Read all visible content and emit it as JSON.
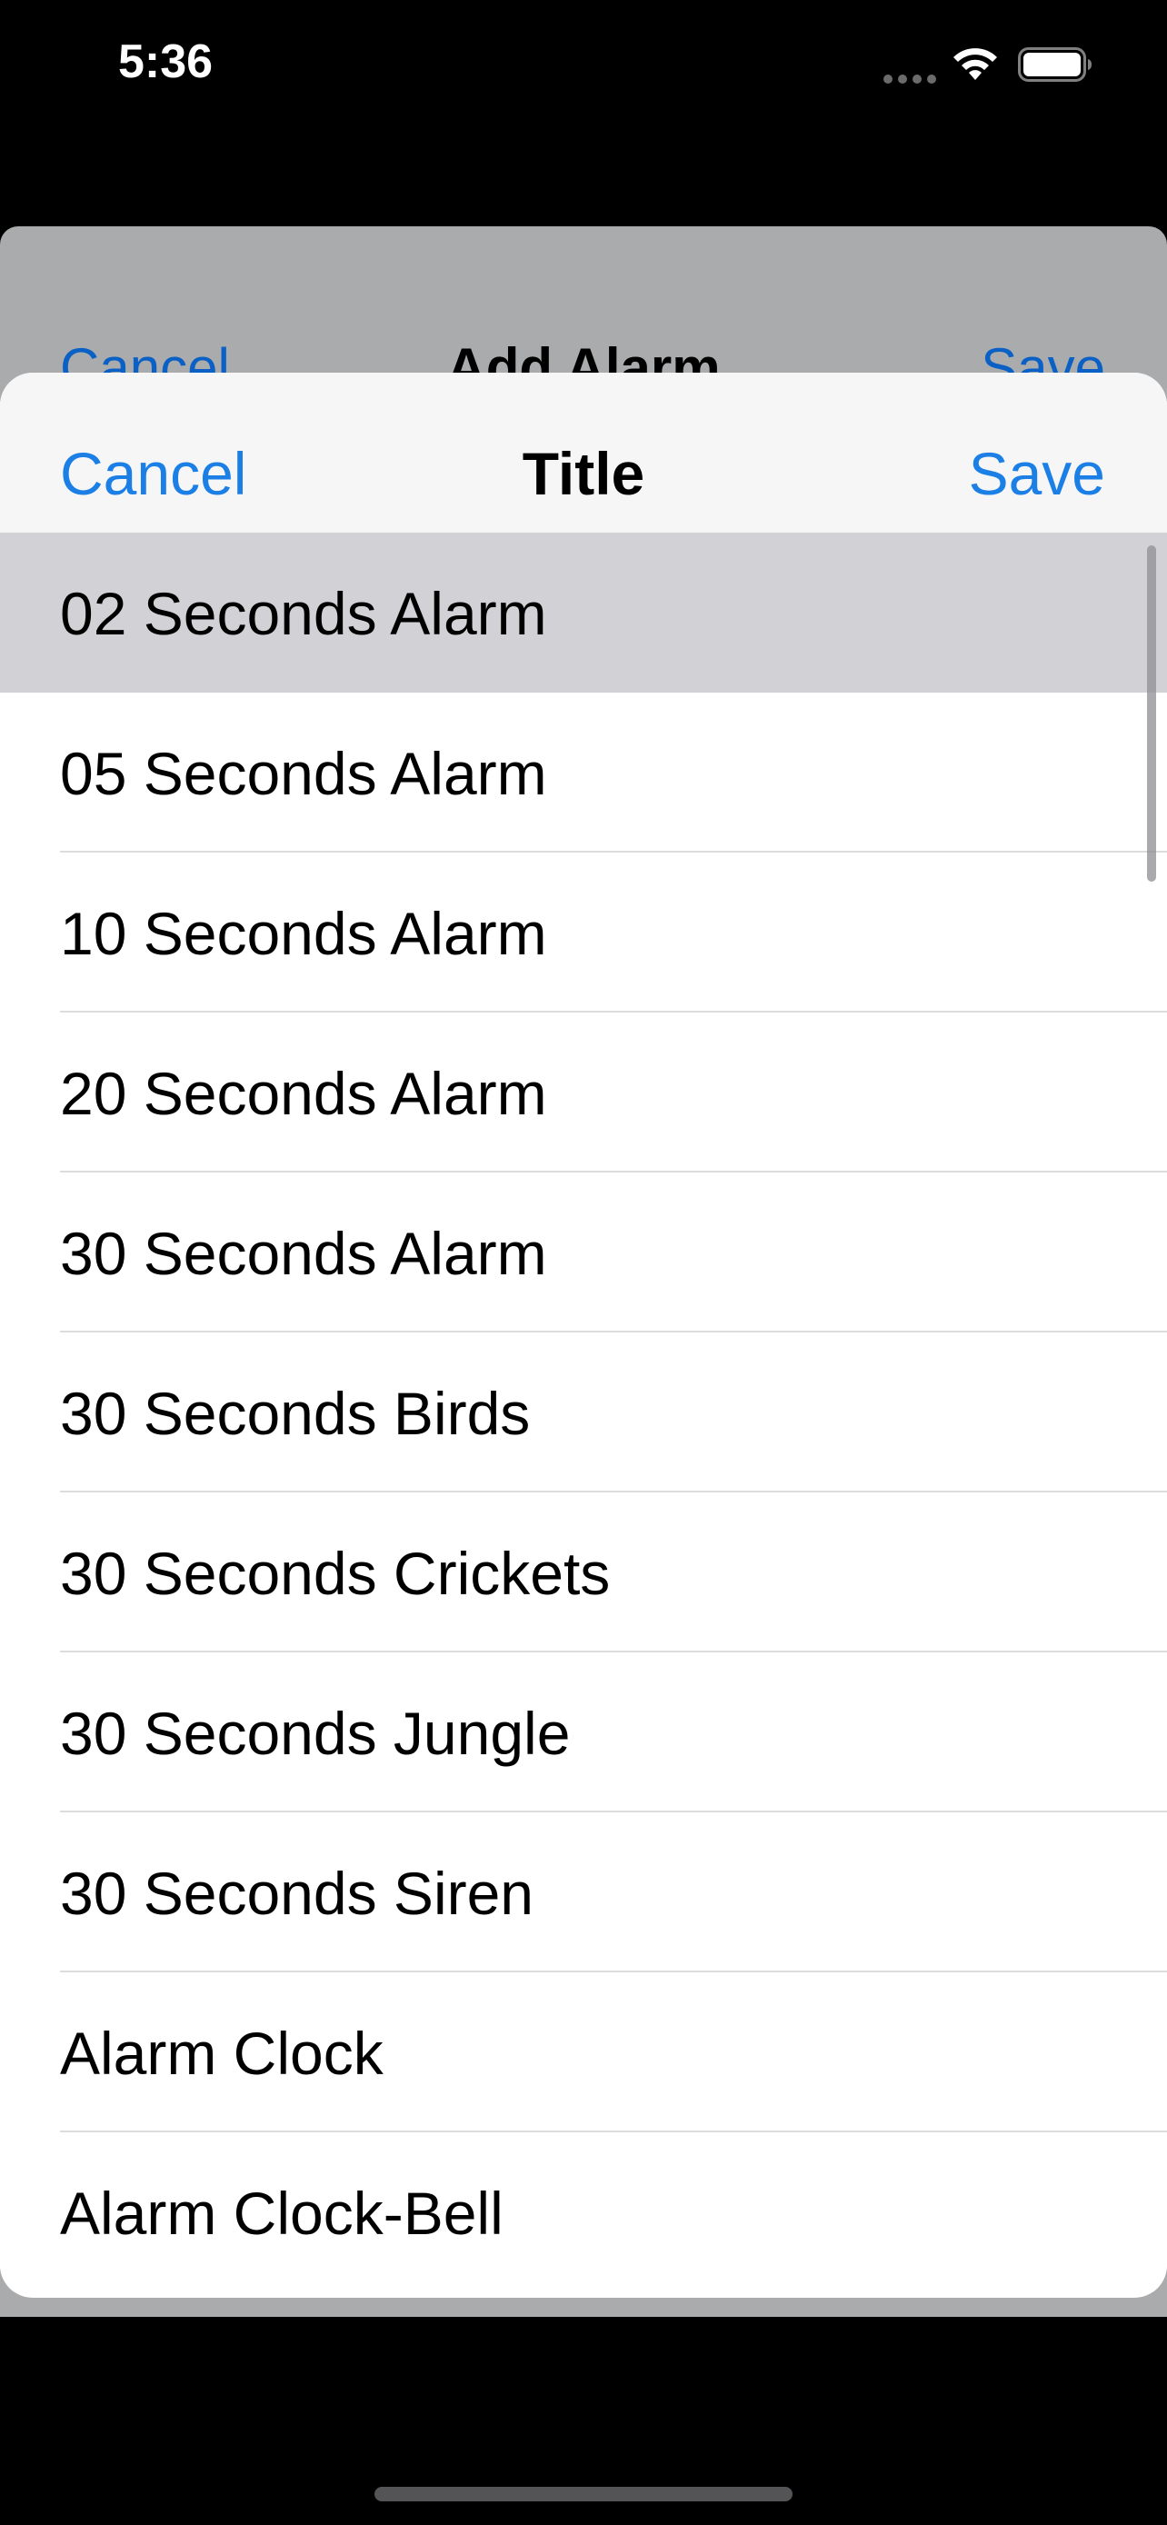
{
  "status_bar": {
    "time": "5:36",
    "signal_icon": "cellular-dots-icon",
    "wifi_icon": "wifi-icon",
    "battery_icon": "battery-full-icon"
  },
  "background_sheet": {
    "cancel_label": "Cancel",
    "title": "Add Alarm",
    "save_label": "Save"
  },
  "nav": {
    "cancel_label": "Cancel",
    "title": "Title",
    "save_label": "Save"
  },
  "colors": {
    "accent": "#1b7fe6",
    "selected_row": "#d1d1d6",
    "nav_background": "#f6f6f6",
    "dim_overlay": "#a9abac"
  },
  "list": {
    "selected_index": 0,
    "items": [
      {
        "label": "02 Seconds Alarm"
      },
      {
        "label": "05 Seconds Alarm"
      },
      {
        "label": "10 Seconds Alarm"
      },
      {
        "label": "20 Seconds Alarm"
      },
      {
        "label": "30 Seconds Alarm"
      },
      {
        "label": "30 Seconds Birds"
      },
      {
        "label": "30 Seconds Crickets"
      },
      {
        "label": "30 Seconds Jungle"
      },
      {
        "label": "30 Seconds Siren"
      },
      {
        "label": "Alarm Clock"
      },
      {
        "label": "Alarm Clock-Bell"
      }
    ]
  }
}
